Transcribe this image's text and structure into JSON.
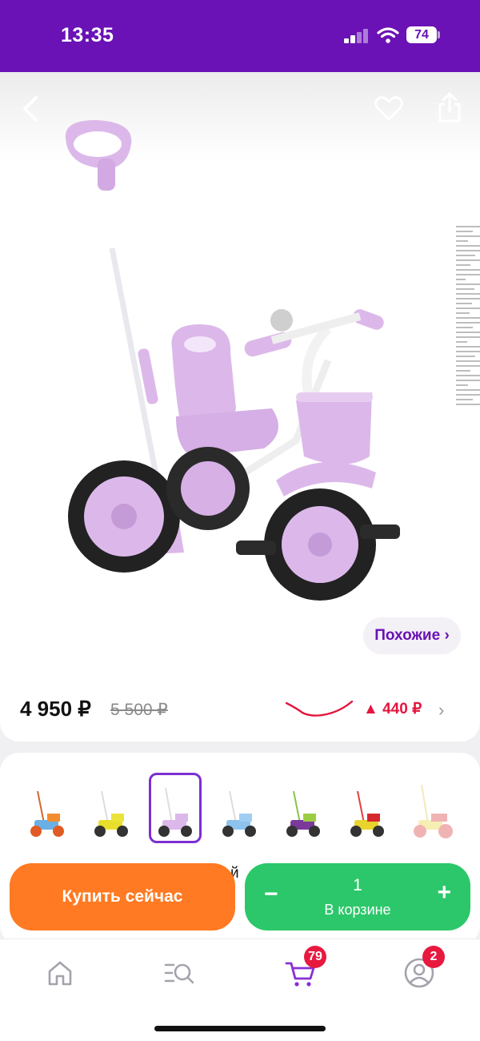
{
  "status_bar": {
    "time": "13:35",
    "battery": "74"
  },
  "product": {
    "similar_label": "Похожие ›",
    "price_now": "4 950 ₽",
    "price_old": "5 500 ₽",
    "price_delta": "▲ 440 ₽"
  },
  "variants": {
    "items": [
      {
        "color": "blue-orange"
      },
      {
        "color": "yellow"
      },
      {
        "color": "pink",
        "selected": true
      },
      {
        "color": "light-blue"
      },
      {
        "color": "green-purple"
      },
      {
        "color": "red-yellow"
      },
      {
        "color": "red-yellow-faded"
      }
    ],
    "cut_text": "й"
  },
  "actions": {
    "buy_now_label": "Купить сейчас",
    "cart_quantity": "1",
    "cart_label": "В корзине",
    "minus_symbol": "−",
    "plus_symbol": "+"
  },
  "tab_bar": {
    "items": [
      {
        "icon": "home-icon"
      },
      {
        "icon": "catalog-search-icon"
      },
      {
        "icon": "cart-icon",
        "badge": "79"
      },
      {
        "icon": "profile-icon",
        "badge": "2"
      }
    ]
  },
  "colors": {
    "brand": "#6a12b5",
    "buy": "#ff7a22",
    "cart": "#2cc76a",
    "alert": "#e3163e",
    "product_pink": "#dcb8ea"
  }
}
